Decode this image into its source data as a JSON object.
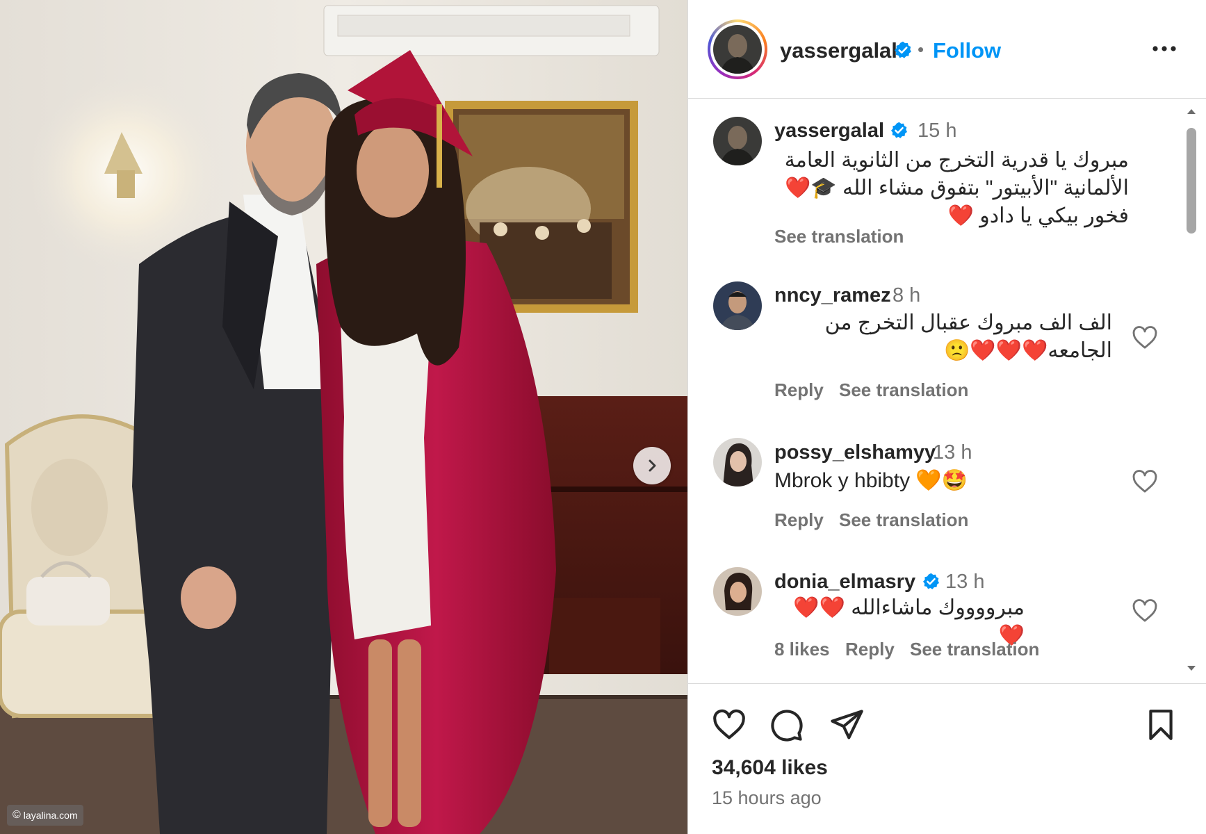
{
  "watermark": {
    "copyright_symbol": "©",
    "text": "layalina.com"
  },
  "header": {
    "username": "yassergalal",
    "verified": true,
    "separator": "•",
    "follow_label": "Follow",
    "more_icon": "more-horizontal-icon"
  },
  "comments": [
    {
      "username": "yassergalal",
      "verified": true,
      "time": "15 h",
      "lines": [
        "مبروك يا قدرية التخرج من الثانوية العامة",
        "الألمانية \"الأبيتور\" بتفوق مشاء الله 🎓❤️",
        "فخور بيكي يا دادو ❤️"
      ],
      "see_translation": "See translation"
    },
    {
      "username": "nncy_ramez",
      "verified": false,
      "time": "8 h",
      "lines": [
        "الف الف مبروك عقبال التخرج من",
        "الجامعه❤️❤️❤️🙁"
      ],
      "reply": "Reply",
      "see_translation": "See translation"
    },
    {
      "username": "possy_elshamyy",
      "verified": false,
      "time": "13 h",
      "text": "Mbrok y hbibty 🧡🤩",
      "reply": "Reply",
      "see_translation": "See translation"
    },
    {
      "username": "donia_elmasry",
      "verified": true,
      "time": "13 h",
      "text": "مبرووووك ماشاءالله ❤️❤️❤️",
      "likes": "8 likes",
      "reply": "Reply",
      "see_translation": "See translation"
    }
  ],
  "actions": {
    "like_icon": "heart-icon",
    "comment_icon": "comment-icon",
    "share_icon": "send-icon",
    "save_icon": "bookmark-icon"
  },
  "likes_count": "34,604 likes",
  "posted": "15 hours ago",
  "colors": {
    "follow_blue": "#0095f6",
    "verified_blue": "#0095f6",
    "text_primary": "#262626",
    "text_secondary": "#737373",
    "gown_red": "#b3123f",
    "suit_dark": "#2b2b30"
  }
}
